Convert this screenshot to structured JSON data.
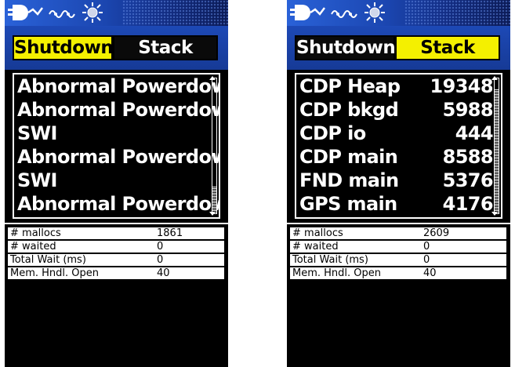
{
  "screens": [
    {
      "tabs": [
        {
          "label": "Shutdown",
          "active": true
        },
        {
          "label": "Stack",
          "active": false
        }
      ],
      "list": [
        {
          "label": "Abnormal Powerdown"
        },
        {
          "label": "Abnormal Powerdown"
        },
        {
          "label": "SWI"
        },
        {
          "label": "Abnormal Powerdown"
        },
        {
          "label": "SWI"
        },
        {
          "label": "Abnormal Powerdown"
        }
      ],
      "stats": [
        {
          "key": "# mallocs",
          "value": "1861"
        },
        {
          "key": "# waited",
          "value": "0"
        },
        {
          "key": "Total Wait (ms)",
          "value": "0"
        },
        {
          "key": "Mem. Hndl. Open",
          "value": "40"
        }
      ]
    },
    {
      "tabs": [
        {
          "label": "Shutdown",
          "active": false
        },
        {
          "label": "Stack",
          "active": true
        }
      ],
      "list": [
        {
          "label": "CDP Heap",
          "value": "19348"
        },
        {
          "label": "CDP bkgd",
          "value": "5988"
        },
        {
          "label": "CDP io",
          "value": "444"
        },
        {
          "label": "CDP main",
          "value": "8588"
        },
        {
          "label": "FND main",
          "value": "5376"
        },
        {
          "label": "GPS main",
          "value": "4176"
        }
      ],
      "stats": [
        {
          "key": "# mallocs",
          "value": "2609"
        },
        {
          "key": "# waited",
          "value": "0"
        },
        {
          "key": "Total Wait (ms)",
          "value": "0"
        },
        {
          "key": "Mem. Hndl. Open",
          "value": "40"
        }
      ]
    }
  ],
  "icons": [
    "power-plug-icon",
    "satellite-signal-icon",
    "backlight-sun-icon"
  ],
  "colors": {
    "active_tab": "#f4f000",
    "statusbar": "#2a62d8",
    "tabbar": "#1d49b6"
  }
}
